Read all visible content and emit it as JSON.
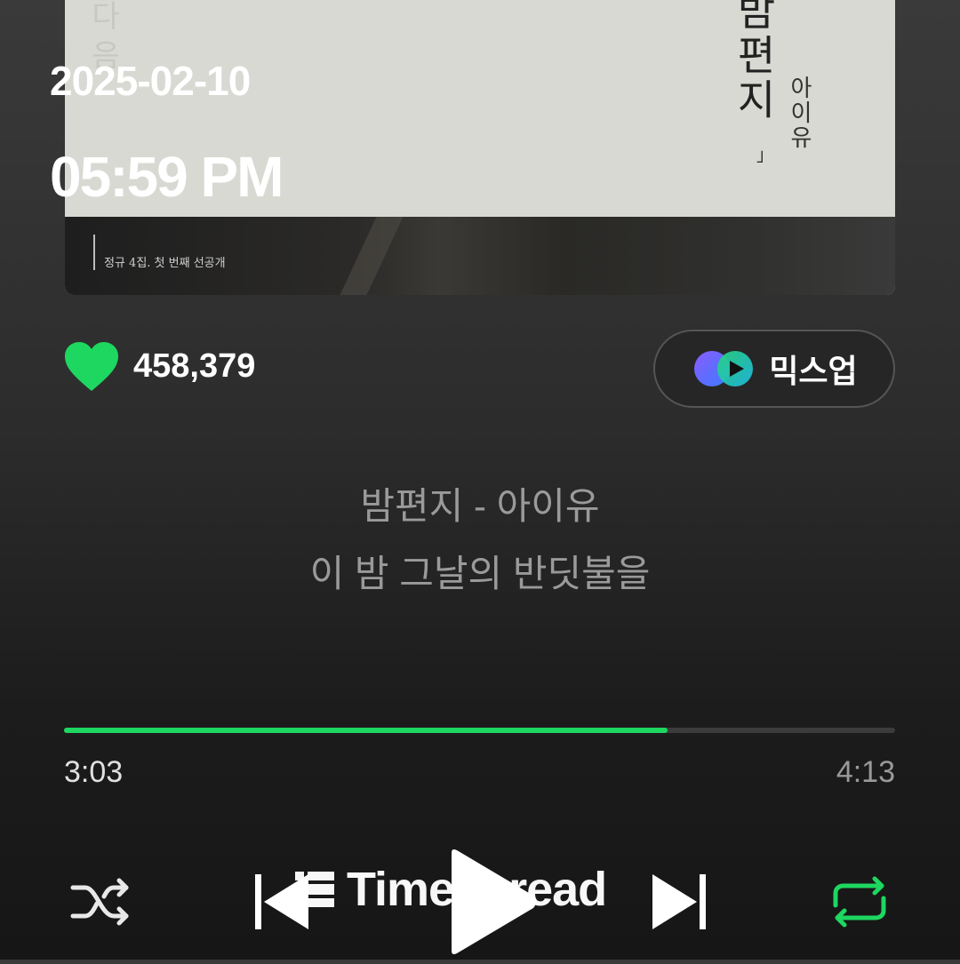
{
  "album": {
    "title": "밤편지",
    "artist": "아이유",
    "ghost_text": "다 음",
    "subtitle": "정규 4집. 첫 번째 선공개"
  },
  "overlay": {
    "date": "2025-02-10",
    "time": "05:59 PM"
  },
  "likes": {
    "count": "458,379",
    "icon": "heart-icon",
    "color": "#1ed760"
  },
  "mixup": {
    "label": "믹스업",
    "icon": "mixup-logo-icon"
  },
  "lyrics": {
    "title_line": "밤편지 - 아이유",
    "current_line": "이 밤 그날의 반딧불을"
  },
  "player": {
    "elapsed": "3:03",
    "total": "4:13",
    "progress": 0.7266,
    "accent": "#1ed760"
  },
  "controls": {
    "shuffle_icon": "shuffle-icon",
    "prev_icon": "previous-track-icon",
    "play_icon": "play-icon",
    "next_icon": "next-track-icon",
    "repeat_icon": "repeat-icon"
  },
  "watermark": {
    "text": "Timespread"
  }
}
